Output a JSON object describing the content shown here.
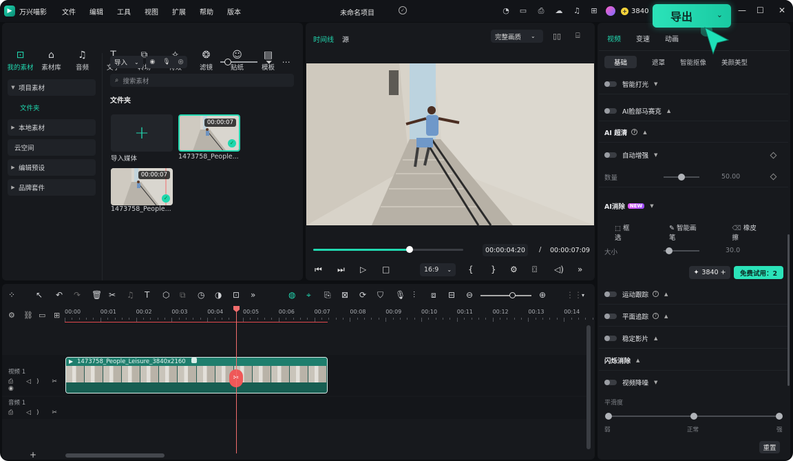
{
  "titlebar": {
    "app_name": "万兴喵影",
    "logo_glyph": "▶",
    "menu": [
      "文件",
      "编辑",
      "工具",
      "视图",
      "扩展",
      "帮助",
      "版本"
    ],
    "project_name": "未命名项目",
    "credits": "3840",
    "export_label": "导出",
    "controls": {
      "minimize": "—",
      "maximize": "☐",
      "close": "✕"
    }
  },
  "media": {
    "tabs": [
      {
        "label": "我的素材",
        "icon": "my-media-icon",
        "glyph": "⊡"
      },
      {
        "label": "素材库",
        "icon": "store-icon",
        "glyph": "⌂"
      },
      {
        "label": "音频",
        "icon": "music-icon",
        "glyph": "♫"
      },
      {
        "label": "文字",
        "icon": "text-icon",
        "glyph": "T"
      },
      {
        "label": "转场",
        "icon": "transition-icon",
        "glyph": "⧉"
      },
      {
        "label": "特效",
        "icon": "effects-icon",
        "glyph": "✧"
      },
      {
        "label": "滤镜",
        "icon": "filter-icon",
        "glyph": "❂"
      },
      {
        "label": "贴纸",
        "icon": "sticker-icon",
        "glyph": "☺"
      },
      {
        "label": "模板",
        "icon": "template-icon",
        "glyph": "▤"
      }
    ],
    "sidebar": [
      {
        "label": "项目素材",
        "kind": "expanded"
      },
      {
        "label": "文件夹",
        "kind": "sub"
      },
      {
        "label": "本地素材",
        "kind": "collapsed"
      },
      {
        "label": "云空间",
        "kind": "plain"
      },
      {
        "label": "编辑预设",
        "kind": "collapsed"
      },
      {
        "label": "品牌套件",
        "kind": "collapsed"
      }
    ],
    "import_label": "导入",
    "search_placeholder": "搜索素材",
    "folder_title": "文件夹",
    "import_media_label": "导入媒体",
    "clips": [
      {
        "name": "1473758_People...",
        "duration": "00:00:07"
      },
      {
        "name": "1473758_People...",
        "duration": "00:00:07"
      }
    ]
  },
  "player": {
    "tab_timeline": "时间线",
    "tab_source": "源",
    "quality": "完整画质",
    "current_time": "00:00:04:20",
    "separator": "/",
    "total_time": "00:00:07:09",
    "progress": 0.64,
    "ratio": "16:9"
  },
  "properties": {
    "tabs": [
      "视频",
      "变速",
      "动画"
    ],
    "subtabs": [
      "基础",
      "遮罩",
      "智能抠像",
      "美颜美型"
    ],
    "smart_light": "智能打光",
    "ai_face_mosaic": "AI脸部马赛克",
    "ai_upscale": "AI 超清",
    "auto_enhance": "自动增强",
    "amount_label": "数量",
    "amount_value": "50.00",
    "ai_remove": "AI消除",
    "new_badge": "NEW",
    "erase_tools": [
      "框选",
      "智能画笔",
      "橡皮擦"
    ],
    "size_label": "大小",
    "size_value": "30.0",
    "credit_count": "3840",
    "free_trial": "免费试用：2",
    "motion_tracking": "运动跟踪",
    "plane_tracking": "平面追踪",
    "stabilize": "稳定影片",
    "flicker_removal": "闪烁消除",
    "video_denoise": "视频降噪",
    "smoothness_label": "平滑度",
    "smooth_levels": [
      "弱",
      "正常",
      "强"
    ],
    "reset_label": "重置"
  },
  "timeline": {
    "ruler": [
      "00:00",
      "00:01",
      "00:02",
      "00:03",
      "00:04",
      "00:05",
      "00:06",
      "00:07",
      "00:08",
      "00:09",
      "00:10",
      "00:11",
      "00:12",
      "00:13",
      "00:14"
    ],
    "tracks": [
      {
        "name": "视频 1",
        "icons": "⎙ ◁) ✂ ◉"
      },
      {
        "name": "音频 1",
        "icons": "⎙ ◁) ✂"
      }
    ],
    "clip_label": "1473758_People_Leisure_3840x2160",
    "add_track": "+"
  },
  "colors": {
    "accent": "#21d8b0",
    "playhead": "#f26d6d"
  }
}
